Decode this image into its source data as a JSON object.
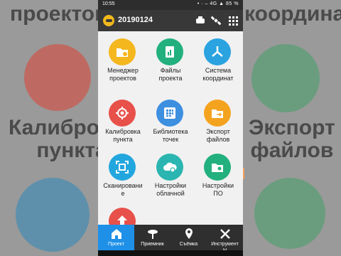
{
  "status": {
    "time": "10:55",
    "right": "• · – 4G ▲ 85 %"
  },
  "header": {
    "title": "20190124"
  },
  "tiles": [
    {
      "label": "Менеджер\nпроектов",
      "color": "#f4b71e",
      "icon": "folder-settings-icon"
    },
    {
      "label": "Файлы\nпроекта",
      "color": "#22b07e",
      "icon": "file-chart-icon"
    },
    {
      "label": "Система\nкоординат",
      "color": "#2aa3e0",
      "icon": "coordinate-system-icon"
    },
    {
      "label": "Калибровка\nпункта",
      "color": "#e8504a",
      "icon": "target-icon"
    },
    {
      "label": "Библиотека\nточек",
      "color": "#3d8fe0",
      "icon": "grid-library-icon"
    },
    {
      "label": "Экспорт\nфайлов",
      "color": "#f4a31e",
      "icon": "folder-export-icon"
    },
    {
      "label": "Сканировани\nе",
      "color": "#22a6de",
      "icon": "qr-scan-icon"
    },
    {
      "label": "Настройки\nоблачной",
      "color": "#2bb5b0",
      "icon": "cloud-settings-icon"
    },
    {
      "label": "Настройки\nПО",
      "color": "#22b07e",
      "icon": "folder-gear-icon"
    },
    {
      "label": "",
      "color": "#e8504a",
      "icon": "upload-arrow-icon"
    }
  ],
  "nav": [
    {
      "label": "Проект",
      "icon": "home-icon",
      "active": true
    },
    {
      "label": "Приемник",
      "icon": "receiver-icon",
      "active": false
    },
    {
      "label": "Съёмка",
      "icon": "location-pin-icon",
      "active": false
    },
    {
      "label": "Инструмент\nы",
      "icon": "tools-icon",
      "active": false
    }
  ],
  "background": {
    "left_top": "проектов",
    "right_top": "координат",
    "left_mid": "Калибровка\nпункта",
    "right_mid": "Экспорт\nфайлов"
  }
}
